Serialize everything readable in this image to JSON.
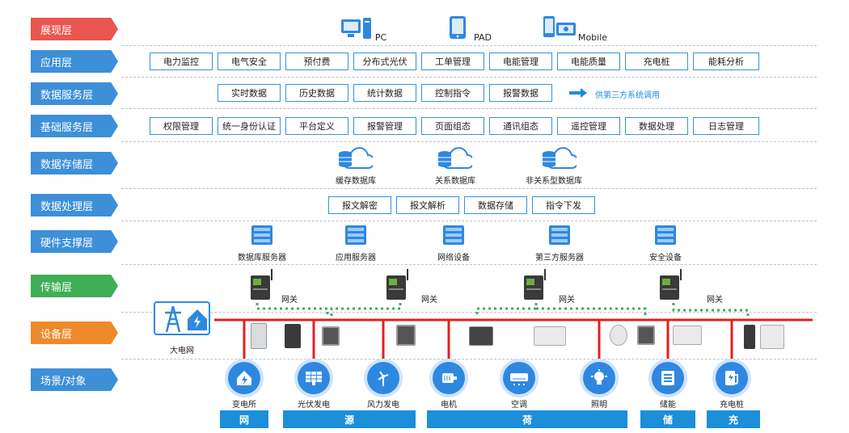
{
  "layers": {
    "presentation": "展现层",
    "application": "应用层",
    "data_service": "数据服务层",
    "base_service": "基础服务层",
    "data_storage": "数据存储层",
    "data_processing": "数据处理层",
    "hardware": "硬件支撑层",
    "transport": "传输层",
    "device": "设备层",
    "scene": "场景/对象"
  },
  "terminals": {
    "pc": "PC",
    "pad": "PAD",
    "mobile": "Mobile"
  },
  "application_items": [
    "电力监控",
    "电气安全",
    "预付费",
    "分布式光伏",
    "工单管理",
    "电能管理",
    "电能质量",
    "充电桩",
    "能耗分析"
  ],
  "data_service_items": [
    "实时数据",
    "历史数据",
    "统计数据",
    "控制指令",
    "报警数据"
  ],
  "third_party_note": "供第三方系统调用",
  "base_service_items": [
    "权限管理",
    "统一身份认证",
    "平台定义",
    "报警管理",
    "页面组态",
    "通讯组态",
    "遥控管理",
    "数据处理",
    "日志管理"
  ],
  "storage_items": [
    "缓存数据库",
    "关系数据库",
    "非关系型数据库"
  ],
  "processing_items": [
    "报文解密",
    "报文解析",
    "数据存储",
    "指令下发"
  ],
  "hardware_items": [
    "数据库服务器",
    "应用服务器",
    "网络设备",
    "第三方服务器",
    "安全设备"
  ],
  "gateway_label": "网关",
  "grid_label": "大电网",
  "scenes": [
    "变电所",
    "光伏发电",
    "风力发电",
    "电机",
    "空调",
    "照明",
    "储能",
    "充电桩"
  ],
  "categories": [
    "网",
    "源",
    "荷",
    "储",
    "充"
  ],
  "colors": {
    "accent": "#1b8fd9",
    "bus": "#e02020",
    "link": "#3fae54"
  }
}
